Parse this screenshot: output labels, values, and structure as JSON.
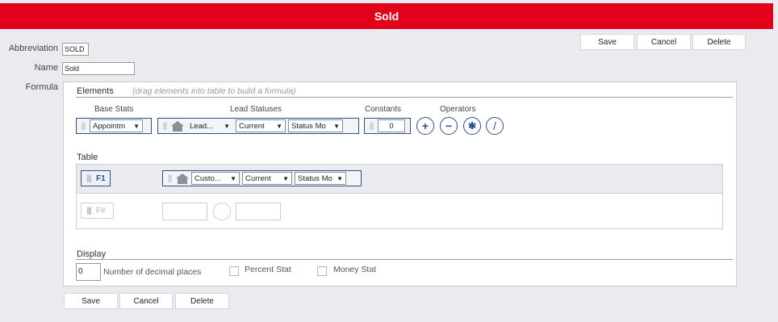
{
  "header": {
    "title": "Sold"
  },
  "toolbar_top": {
    "save": "Save",
    "cancel": "Cancel",
    "delete": "Delete"
  },
  "toolbar_bottom": {
    "save": "Save",
    "cancel": "Cancel",
    "delete": "Delete"
  },
  "form": {
    "abbreviation_label": "Abbreviation",
    "abbreviation_value": "SOLD",
    "name_label": "Name",
    "name_value": "Sold",
    "formula_label": "Formula"
  },
  "elements": {
    "title": "Elements",
    "hint": "(drag elements into table to build a formula)",
    "base_stats": {
      "label": "Base Stats",
      "select": "Appointm"
    },
    "lead_statuses": {
      "label": "Lead Statuses",
      "status": "Lead...",
      "period": "Current",
      "mode": "Status Mo"
    },
    "constants": {
      "label": "Constants",
      "value": "0"
    },
    "operators": {
      "label": "Operators",
      "items": [
        "+",
        "−",
        "✱",
        "/"
      ]
    }
  },
  "table": {
    "title": "Table",
    "row1": {
      "field": "F1",
      "status": "Custo...",
      "period": "Current",
      "mode": "Status Mo"
    },
    "row2": {
      "field": "F#"
    }
  },
  "display": {
    "title": "Display",
    "decimal_value": "0",
    "decimal_label": "Number of decimal places",
    "percent_label": "Percent Stat",
    "money_label": "Money Stat"
  },
  "colors": {
    "brand": "#e2001a",
    "accent": "#2f4f8f"
  },
  "icons": [
    "drag-handle-icon",
    "house-icon",
    "dropdown-arrow-icon",
    "plus-icon",
    "minus-icon",
    "multiply-icon",
    "divide-icon"
  ]
}
